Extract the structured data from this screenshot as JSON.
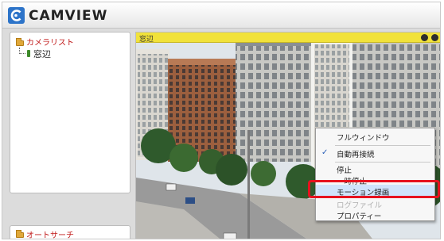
{
  "app": {
    "title": "CAMVIEW",
    "logo_icon": "camview-logo-icon"
  },
  "sidebar": {
    "camera_list_label": "カメラリスト",
    "cameras": [
      {
        "label": "窓辺",
        "icon": "camera-icon"
      }
    ],
    "auto_search_label": "オートサーチ"
  },
  "viewer": {
    "title": "窓辺",
    "header_buttons": [
      "record-icon",
      "close-icon"
    ],
    "header_color": "#f1e23a"
  },
  "context_menu": {
    "items": [
      {
        "label": "フルウィンドウ",
        "checked": false
      },
      {
        "label": "自動再接続",
        "checked": true
      },
      {
        "label": "停止",
        "checked": false
      },
      {
        "label": "一時停止",
        "checked": false
      },
      {
        "label": "モーション録画",
        "checked": false,
        "highlighted": true
      },
      {
        "label": "ログファイル",
        "checked": false,
        "disabled": true
      },
      {
        "label": "プロパティー",
        "checked": false
      }
    ],
    "highlight_color": "#e6121f"
  }
}
